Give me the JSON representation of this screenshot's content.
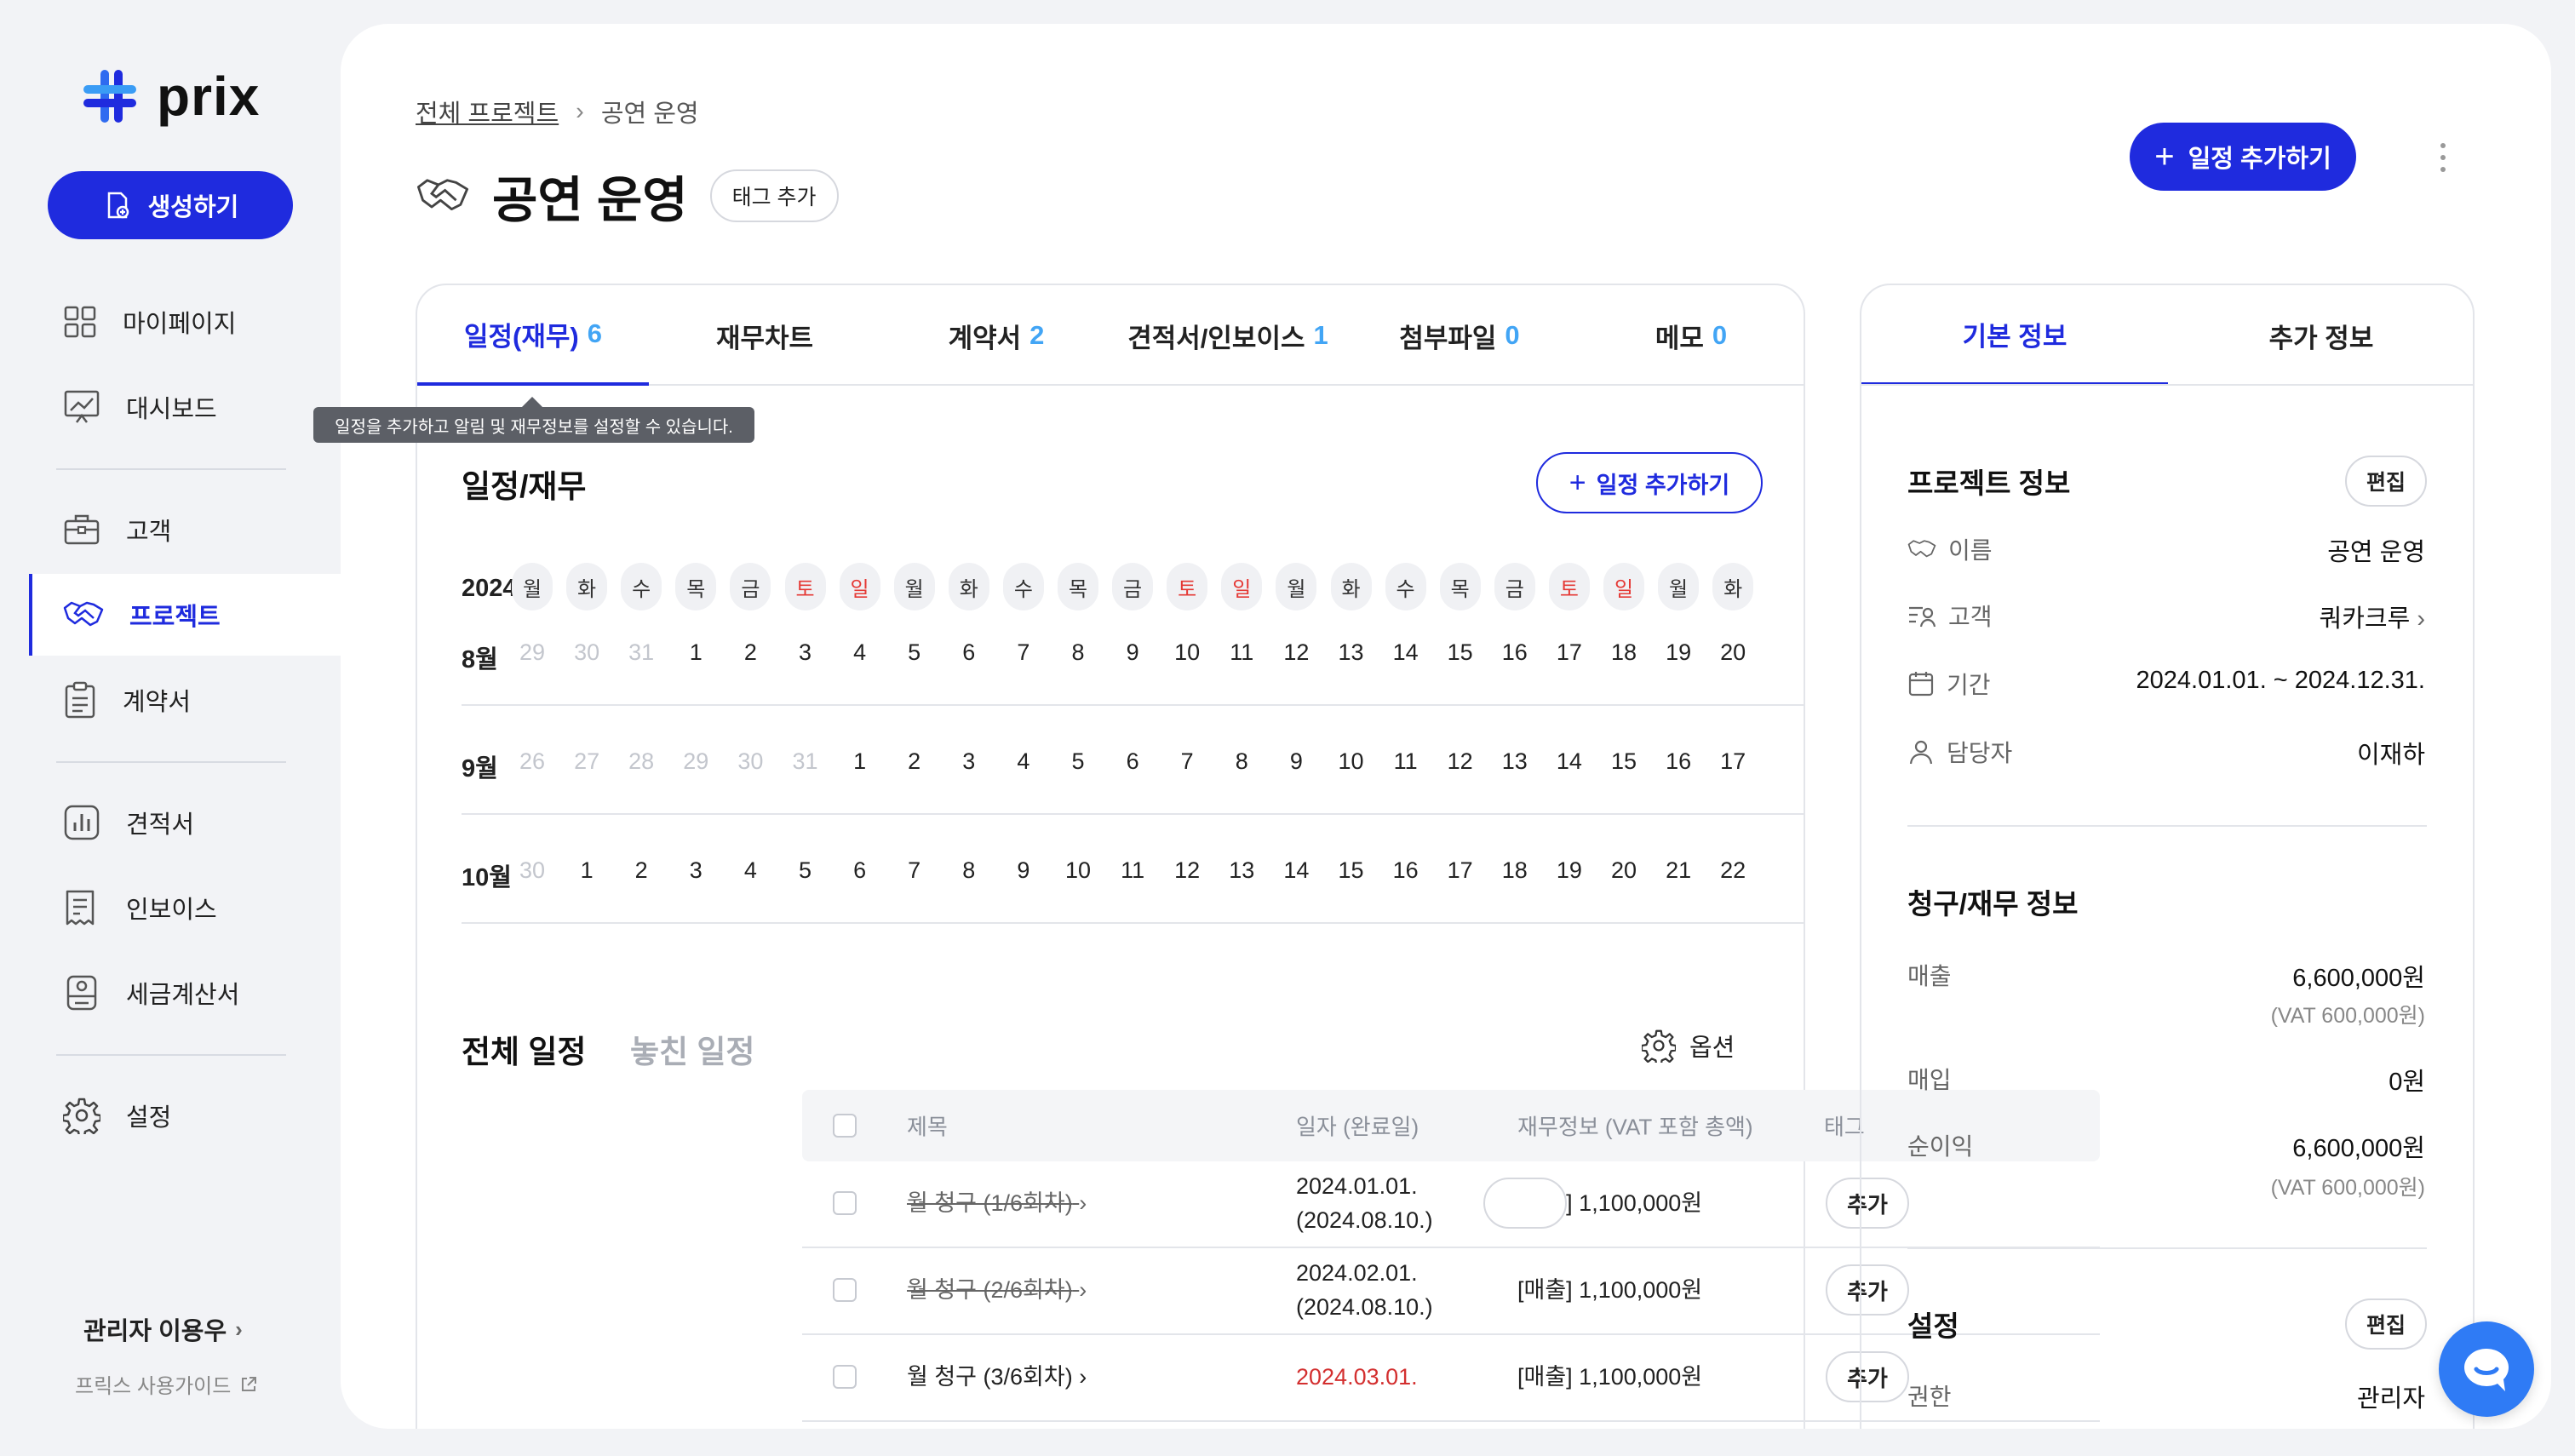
{
  "brand": {
    "name": "prix",
    "accent": "#1f2bde"
  },
  "sidebar": {
    "create_label": "생성하기",
    "items": [
      {
        "label": "마이페이지",
        "icon": "grid-icon"
      },
      {
        "label": "대시보드",
        "icon": "chart-board-icon"
      },
      {
        "label": "고객",
        "icon": "briefcase-icon"
      },
      {
        "label": "프로젝트",
        "icon": "handshake-icon"
      },
      {
        "label": "계약서",
        "icon": "clipboard-icon"
      },
      {
        "label": "견적서",
        "icon": "bar-doc-icon"
      },
      {
        "label": "인보이스",
        "icon": "invoice-icon"
      },
      {
        "label": "세금계산서",
        "icon": "tax-icon"
      },
      {
        "label": "설정",
        "icon": "gear-icon"
      }
    ],
    "admin_name": "관리자 이용우",
    "guide_label": "프릭스 사용가이드"
  },
  "header": {
    "breadcrumb_root": "전체 프로젝트",
    "breadcrumb_current": "공연 운영",
    "title": "공연 운영",
    "tag_label": "태그 추가",
    "add_schedule_label": "일정 추가하기"
  },
  "tabs": [
    {
      "label": "일정(재무)",
      "count": "6"
    },
    {
      "label": "재무차트",
      "count": ""
    },
    {
      "label": "계약서",
      "count": "2"
    },
    {
      "label": "견적서/인보이스",
      "count": "1"
    },
    {
      "label": "첨부파일",
      "count": "0"
    },
    {
      "label": "메모",
      "count": "0"
    }
  ],
  "tooltip": "일정을 추가하고 알림 및 재무정보를 설정할 수 있습니다.",
  "schedule": {
    "title": "일정/재무",
    "add_label": "일정 추가하기",
    "year": "2024년",
    "weekdays": [
      "월",
      "화",
      "수",
      "목",
      "금",
      "토",
      "일",
      "월",
      "화",
      "수",
      "목",
      "금",
      "토",
      "일",
      "월",
      "화",
      "수",
      "목",
      "금",
      "토",
      "일",
      "월",
      "화"
    ],
    "months": [
      {
        "label": "8월",
        "days": [
          "29",
          "30",
          "31",
          "1",
          "2",
          "3",
          "4",
          "5",
          "6",
          "7",
          "8",
          "9",
          "10",
          "11",
          "12",
          "13",
          "14",
          "15",
          "16",
          "17",
          "18",
          "19",
          "20"
        ],
        "muted_count": 3
      },
      {
        "label": "9월",
        "days": [
          "26",
          "27",
          "28",
          "29",
          "30",
          "31",
          "1",
          "2",
          "3",
          "4",
          "5",
          "6",
          "7",
          "8",
          "9",
          "10",
          "11",
          "12",
          "13",
          "14",
          "15",
          "16",
          "17"
        ],
        "muted_count": 6
      },
      {
        "label": "10월",
        "days": [
          "30",
          "1",
          "2",
          "3",
          "4",
          "5",
          "6",
          "7",
          "8",
          "9",
          "10",
          "11",
          "12",
          "13",
          "14",
          "15",
          "16",
          "17",
          "18",
          "19",
          "20",
          "21",
          "22"
        ],
        "muted_count": 1
      }
    ]
  },
  "list": {
    "tab_all": "전체 일정",
    "tab_missed": "놓친 일정",
    "options_label": "옵션",
    "columns": [
      "제목",
      "일자 (완료일)",
      "재무정보 (VAT 포함 총액)",
      "태그"
    ],
    "rows": [
      {
        "title": "월 청구 (1/6회차)",
        "date": "2024.01.01.",
        "done": "(2024.08.10.)",
        "finance": "[매출] 1,100,000원",
        "tag": "추가"
      },
      {
        "title": "월 청구 (2/6회차)",
        "date": "2024.02.01.",
        "done": "(2024.08.10.)",
        "finance": "[매출] 1,100,000원",
        "tag": "추가"
      },
      {
        "title": "월 청구 (3/6회차)",
        "date": "2024.03.01.",
        "done": "",
        "finance": "[매출] 1,100,000원",
        "tag": "추가"
      }
    ]
  },
  "info": {
    "tab_basic": "기본 정보",
    "tab_extra": "추가 정보",
    "project_title": "프로젝트 정보",
    "edit_label": "편집",
    "name_label": "이름",
    "name_value": "공연 운영",
    "client_label": "고객",
    "client_value": "쿼카크루",
    "period_label": "기간",
    "period_value": "2024.01.01. ~ 2024.12.31.",
    "manager_label": "담당자",
    "manager_value": "이재하",
    "billing_title": "청구/재무 정보",
    "sales_label": "매출",
    "sales_value": "6,600,000원",
    "sales_vat": "(VAT 600,000원)",
    "purchase_label": "매입",
    "purchase_value": "0원",
    "profit_label": "순이익",
    "profit_value": "6,600,000원",
    "profit_vat": "(VAT 600,000원)",
    "settings_title": "설정",
    "perm_label": "권한",
    "perm_value": "관리자"
  }
}
